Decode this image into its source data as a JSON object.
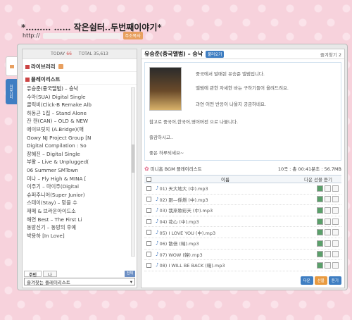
{
  "blog": {
    "title": "*……… …… 작은쉼터..두번째이야기*",
    "url_prefix": "http://",
    "url_badge": "주소복사"
  },
  "side_tabs": {
    "blue_tab": "커뮤니티"
  },
  "left": {
    "today_label": "TODAY",
    "today_value": "66",
    "total_label": "TOTAL",
    "total_value": "35,613",
    "library_label": "라이브러리",
    "playlist_label": "플레이리스트",
    "playlists": [
      "유승준(중국앨범) – 승낙",
      "수아(SUA) Digital Single",
      "클릭비(Click-B Remake Alb",
      "하동균 1집 – Stand Alone",
      "잔 캔(CAN) – OLD & NEW",
      "에이브릿지 (A.Bridge)(매",
      "Gowy NJ Project Group [N",
      "Digital Compilation : So",
      "장혜진 – Digital Single",
      "부활 – Live & Unplugged(",
      "06 Summer SMTown",
      "미나 – Fly High & MINA [",
      "이주기 – 마이주(Digital",
      "슈퍼주니어(Super Junior)",
      "스테이(Stay) – 믿을 수",
      "재패 & 브라운아이드소",
      "해연 Best – The First Li",
      "동방신기 – 동방의 후예",
      "박용하 [In Love]"
    ],
    "bottom_tab_1": "주인",
    "bottom_tab_2": "나",
    "bottom_badge": "전체",
    "fav_select": "즐겨찾는 플레이리스트"
  },
  "right": {
    "album_title": "유승준(중국앨범) – 승낙",
    "chip": "불러오기",
    "fav_count": "즐겨찾기 2",
    "desc_lines": [
      "중국에서 발매된 유승준 앨범입니다.",
      "앨범에 관한 자세한 바는 구하기들어 올려드려요.",
      "과연 어떤 반응이 나올지 궁금하네요.",
      "참고로 중국어,한국어,영어버전 으로 나불니다.",
      "즐감하시고..",
      "좋은 하루되세요~"
    ],
    "playlist_label": "미니홈 BGM 플레이리스트",
    "playlist_meta": "10곡 : 총 00:41분초 : 56.7MB",
    "col_title": "이름",
    "col_actions": "다운 선물 듣기",
    "tracks": [
      "01) 天大地大 (中).mp3",
      "02) 跟—係燃 (中).mp3",
      "03) 我來歌彩天 (中).mp3",
      "04) 花心 (中).mp3",
      "05) I LOVE YOU (中).mp3",
      "06) 散倍 (韓).mp3",
      "07) WOW (韓).mp3",
      "08) I WILL BE BACK (韓).mp3"
    ],
    "btn_1": "다운",
    "btn_2": "선물",
    "btn_3": "듣기"
  }
}
